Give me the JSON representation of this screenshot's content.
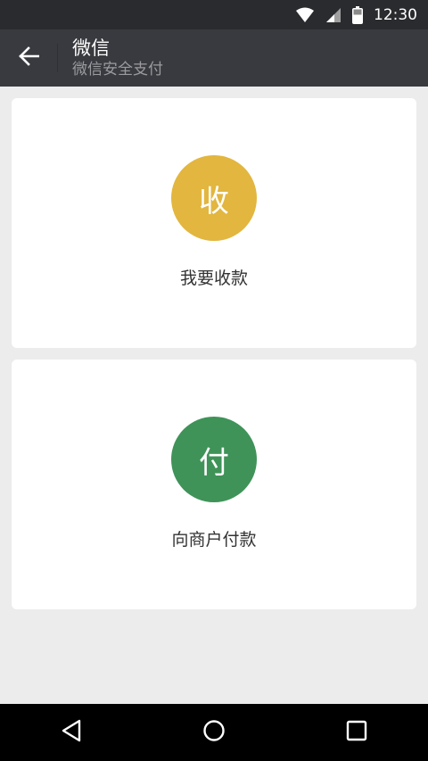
{
  "status_bar": {
    "time": "12:30",
    "icons": [
      "wifi-icon",
      "cell-signal-icon",
      "battery-icon"
    ]
  },
  "app_bar": {
    "back_icon": "back-arrow-icon",
    "title": "微信",
    "subtitle": "微信安全支付"
  },
  "cards": [
    {
      "badge": "收",
      "label": "我要收款",
      "color": "#e2b63f"
    },
    {
      "badge": "付",
      "label": "向商户付款",
      "color": "#3f9358"
    }
  ],
  "nav_bar": {
    "icons": [
      "back-triangle-icon",
      "home-circle-icon",
      "recents-square-icon"
    ]
  }
}
